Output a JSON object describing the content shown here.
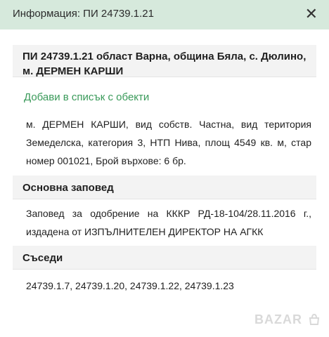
{
  "header": {
    "title": "Информация: ПИ 24739.1.21",
    "close_symbol": "✕"
  },
  "property": {
    "title": "ПИ 24739.1.21 област Варна, община Бяла, с. Дюлино, м. ДЕРМЕН КАРШИ",
    "add_link": "Добави в списък с обекти",
    "description": "м. ДЕРМЕН КАРШИ, вид собств. Частна, вид територия Земеделска, категория 3, НТП Нива, площ 4549 кв. м, стар номер 001021, Брой върхове: 6 бр."
  },
  "order_section": {
    "heading": "Основна заповед",
    "text": "Заповед за одобрение на КККР РД-18-104/28.11.2016 г., издадена от ИЗПЪЛНИТЕЛЕН ДИРЕКТОР НА АГКК"
  },
  "neighbors_section": {
    "heading": "Съседи",
    "text": "24739.1.7, 24739.1.20, 24739.1.22, 24739.1.23"
  },
  "watermark": {
    "text": "BAZAR",
    "icon": "bag-icon"
  }
}
